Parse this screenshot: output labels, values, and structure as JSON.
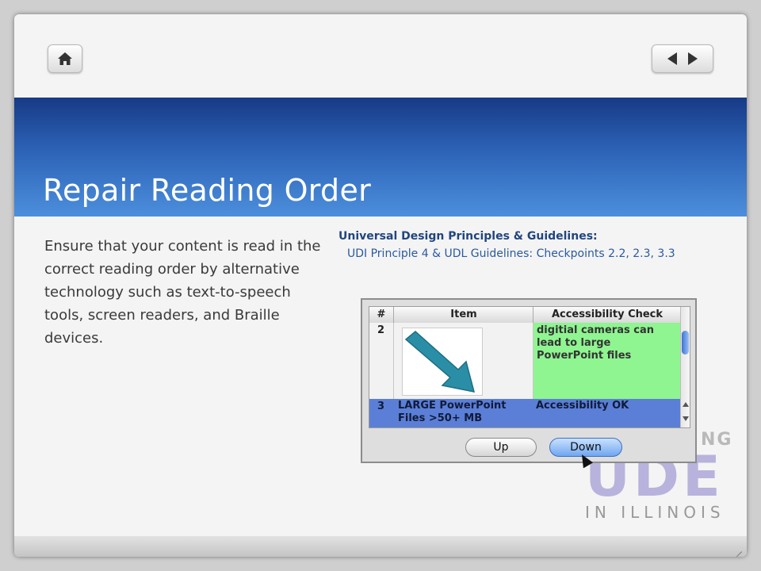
{
  "slide": {
    "title": "Repair Reading Order",
    "body": "Ensure that your content is read in the correct reading order by alternative technology such as text-to-speech tools, screen readers, and Braille devices.",
    "udl_heading": "Universal Design Principles & Guidelines:",
    "udl_line": "UDI Principle 4 & UDL Guidelines: Checkpoints 2.2, 2.3, 3.3"
  },
  "nav": {
    "home_icon": "home-icon",
    "prev_icon": "triangle-left-icon",
    "next_icon": "triangle-right-icon"
  },
  "dialog": {
    "columns": [
      "#",
      "Item",
      "Accessibility Check"
    ],
    "rows": [
      {
        "num": "2",
        "item": "",
        "check": "digitial cameras can lead to large PowerPoint files"
      },
      {
        "num": "3",
        "item": "LARGE PowerPoint Files >50+ MB",
        "check": "Accessibility OK"
      }
    ],
    "up_label": "Up",
    "down_label": "Down"
  },
  "logo": {
    "top": "NG",
    "letters": "UDE",
    "bottom": "IN ILLINOIS"
  },
  "colors": {
    "title_band_top": "#173a86",
    "title_band_bottom": "#4c8fdc",
    "check_green": "#8ff591",
    "selected_row": "#5b7fd6",
    "arrow_teal": "#2a8fa6"
  }
}
